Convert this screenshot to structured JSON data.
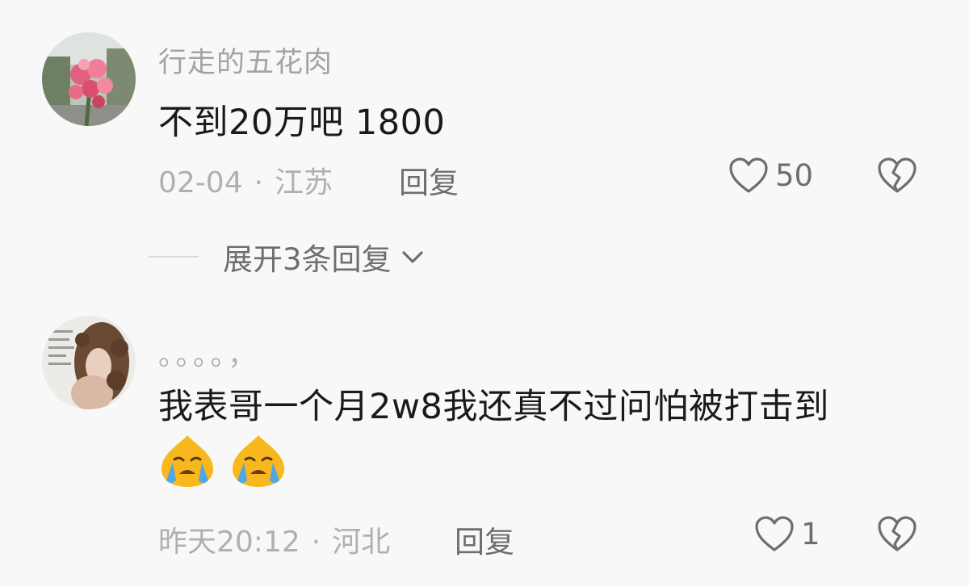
{
  "comments": [
    {
      "username": "行走的五花肉",
      "content": "不到20万吧 1800",
      "date": "02-04",
      "dot": "·",
      "location": "江苏",
      "reply_label": "回复",
      "likes": "50",
      "avatar_icon": "pink-flowers-photo"
    },
    {
      "username": "。。。。，",
      "content": "我表哥一个月2w8我还真不过问怕被打击到",
      "emojis": [
        "crying-face-emoji",
        "crying-face-emoji"
      ],
      "date": "昨天20:12",
      "dot": "·",
      "location": "河北",
      "reply_label": "回复",
      "likes": "1",
      "avatar_icon": "curly-hair-woman-photo"
    }
  ],
  "expand_replies": {
    "label": "展开3条回复"
  },
  "colors": {
    "background": "#f8f8f8",
    "username": "#a3a3a3",
    "content": "#1a1a1a",
    "meta": "#b0b0b0",
    "action": "#6e6e6e"
  }
}
